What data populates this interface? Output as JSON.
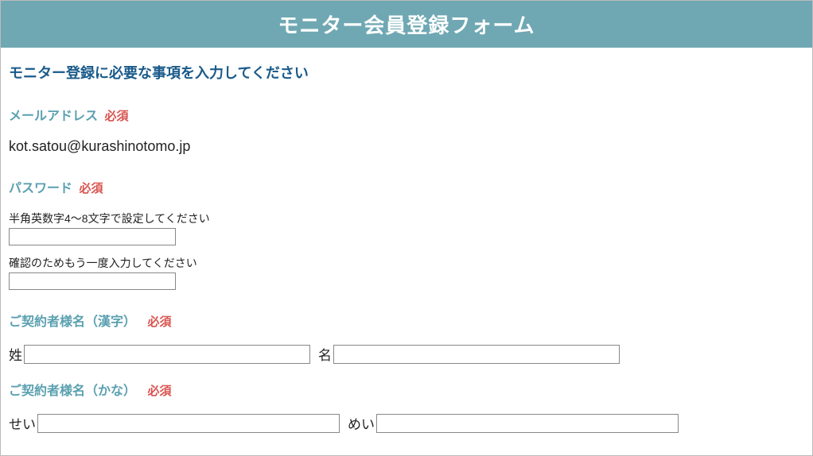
{
  "header": {
    "title": "モニター会員登録フォーム"
  },
  "intro": "モニター登録に必要な事項を入力してください",
  "required_label": "必須",
  "email": {
    "label": "メールアドレス",
    "value": "kot.satou@kurashinotomo.jp"
  },
  "password": {
    "label": "パスワード",
    "hint1": "半角英数字4～8文字で設定してください",
    "hint2": "確認のためもう一度入力してください"
  },
  "name_kanji": {
    "label": "ご契約者様名（漢字）",
    "sei_label": "姓",
    "mei_label": "名"
  },
  "name_kana": {
    "label": "ご契約者様名（かな）",
    "sei_label": "せい",
    "mei_label": "めい"
  }
}
